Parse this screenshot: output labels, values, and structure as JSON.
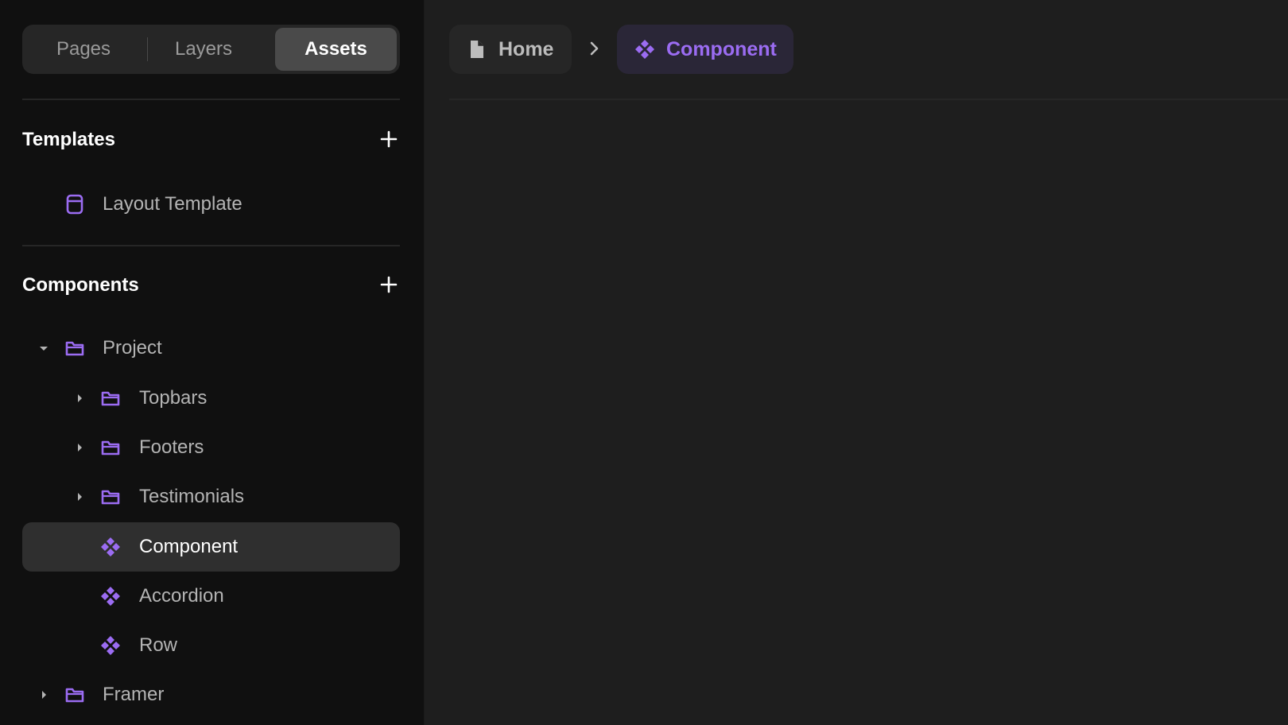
{
  "colors": {
    "accent": "#9b6cf2",
    "sidebar_bg": "#101010",
    "main_bg": "#1e1e1e",
    "selected_row_bg": "#2f2f2f"
  },
  "sidebar": {
    "tabs": [
      {
        "label": "Pages"
      },
      {
        "label": "Layers"
      },
      {
        "label": "Assets",
        "active": true
      }
    ],
    "templates": {
      "title": "Templates",
      "items": [
        {
          "label": "Layout Template",
          "icon": "template-icon"
        }
      ]
    },
    "components": {
      "title": "Components",
      "tree": [
        {
          "label": "Project",
          "icon": "folder-icon",
          "expanded": true
        },
        {
          "label": "Topbars",
          "icon": "folder-icon",
          "expanded": false
        },
        {
          "label": "Footers",
          "icon": "folder-icon",
          "expanded": false
        },
        {
          "label": "Testimonials",
          "icon": "folder-icon",
          "expanded": false
        },
        {
          "label": "Component",
          "icon": "component-icon",
          "selected": true
        },
        {
          "label": "Accordion",
          "icon": "component-icon"
        },
        {
          "label": "Row",
          "icon": "component-icon"
        },
        {
          "label": "Framer",
          "icon": "folder-icon",
          "expanded": false
        }
      ]
    }
  },
  "breadcrumb": {
    "home_label": "Home",
    "current_label": "Component"
  }
}
